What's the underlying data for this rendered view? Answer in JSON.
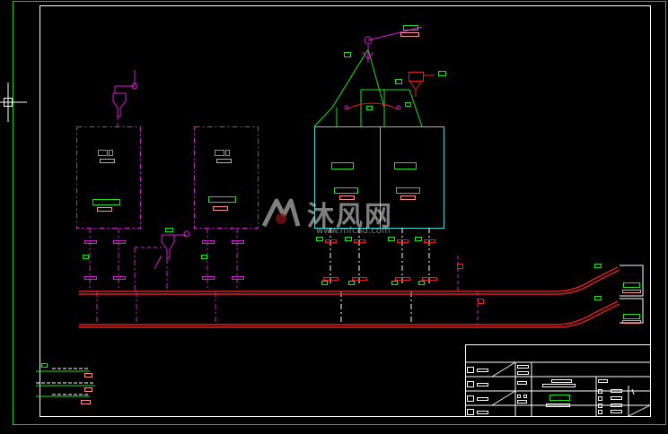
{
  "drawing": {
    "background": "#000000",
    "colors": {
      "frame": "#18c818",
      "border": "#ffffff",
      "magenta": "#d21ed2",
      "cyan": "#40d8d8",
      "red": "#e02020",
      "green": "#20e020",
      "pink": "#ff9090",
      "white": "#ffffff"
    }
  },
  "watermark": {
    "text": "沐风网",
    "url": "www.mfcad.com"
  }
}
